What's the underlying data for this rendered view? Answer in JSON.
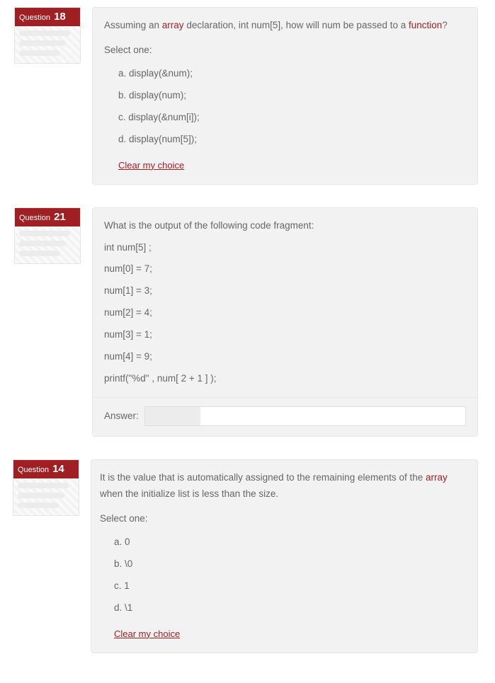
{
  "questions": [
    {
      "badge_prefix": "Question",
      "number": "18",
      "stem_before": "Assuming an ",
      "stem_kw1": "array",
      "stem_mid": " declaration, int num[5], how will num be passed to a ",
      "stem_kw2": "function",
      "stem_after": "?",
      "select_label": "Select one:",
      "opts": {
        "a": "a. display(&num);",
        "b": "b. display(num);",
        "c": "c. display(&num[i]);",
        "d": "d. display(num[5]);"
      },
      "clear": "Clear my choice"
    },
    {
      "badge_prefix": "Question",
      "number": "21",
      "intro": "What is the output of the following code fragment:",
      "lines": {
        "l1": "int num[5] ;",
        "l2": "num[0] = 7;",
        "l3": "num[1] = 3;",
        "l4": "num[2] = 4;",
        "l5": "num[3] = 1;",
        "l6": "num[4] = 9;",
        "l7": "printf(\"%d\" , num[ 2 + 1 ] );"
      },
      "answer_label": "Answer:"
    },
    {
      "badge_prefix": "Question",
      "number": "14",
      "stem_before": "It is the value that is automatically assigned to the remaining elements of the ",
      "stem_kw1": "array",
      "stem_after": " when the initialize list is less than the size.",
      "select_label": "Select one:",
      "opts": {
        "a": "a. 0",
        "b": "b. \\0",
        "c": "c. 1",
        "d": "d. \\1"
      },
      "clear": "Clear my choice"
    }
  ]
}
